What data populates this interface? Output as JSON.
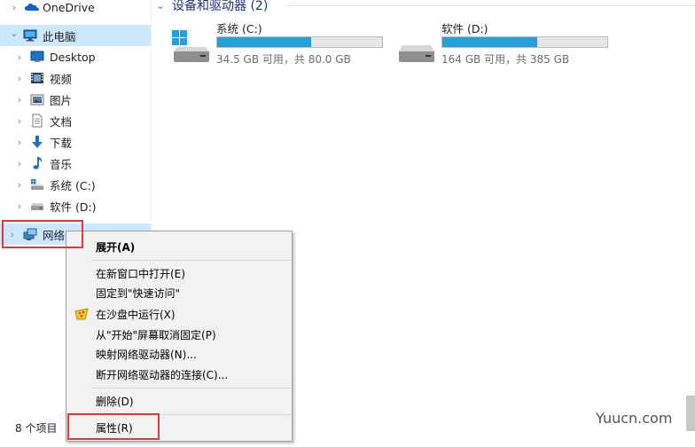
{
  "nav": {
    "items": [
      {
        "label": "OneDrive",
        "icon": "onedrive-cloud-icon",
        "chevron": "›"
      },
      {
        "label": "此电脑",
        "icon": "this-pc-icon",
        "chevron": "⌄"
      },
      {
        "label": "Desktop",
        "icon": "desktop-folder-icon",
        "chevron": "›"
      },
      {
        "label": "视频",
        "icon": "videos-folder-icon",
        "chevron": "›"
      },
      {
        "label": "图片",
        "icon": "pictures-folder-icon",
        "chevron": "›"
      },
      {
        "label": "文档",
        "icon": "documents-folder-icon",
        "chevron": "›"
      },
      {
        "label": "下载",
        "icon": "downloads-arrow-icon",
        "chevron": "›"
      },
      {
        "label": "音乐",
        "icon": "music-note-icon",
        "chevron": "›"
      },
      {
        "label": "系统 (C:)",
        "icon": "system-drive-icon",
        "chevron": "›"
      },
      {
        "label": "软件 (D:)",
        "icon": "drive-icon",
        "chevron": "›"
      },
      {
        "label": "网络",
        "icon": "network-icon",
        "chevron": "›"
      }
    ]
  },
  "main": {
    "section_title": "设备和驱动器 (2)",
    "section_chevron": "⌄",
    "drives": [
      {
        "name": "系统 (C:)",
        "info": "34.5 GB 可用，共 80.0 GB",
        "used_fraction": 0.569,
        "icon": "windows-drive-icon"
      },
      {
        "name": "软件 (D:)",
        "info": "164 GB 可用，共 385 GB",
        "used_fraction": 0.574,
        "icon": "hard-drive-icon"
      }
    ]
  },
  "context_menu": {
    "items": [
      {
        "label": "展开(A)",
        "bold": true
      },
      {
        "label": "在新窗口中打开(E)"
      },
      {
        "label": "固定到\"快速访问\""
      },
      {
        "label": "在沙盘中运行(X)",
        "icon": "sandbox-icon"
      },
      {
        "label": "从\"开始\"屏幕取消固定(P)"
      },
      {
        "label": "映射网络驱动器(N)..."
      },
      {
        "label": "断开网络驱动器的连接(C)..."
      },
      {
        "label": "删除(D)"
      },
      {
        "label": "属性(R)"
      }
    ]
  },
  "status": {
    "item_count": "8 个项目"
  },
  "watermark": "Yuucn.com",
  "colors": {
    "selection": "#cce8ff",
    "drive_bar_fill": "#26a0da",
    "highlight_box": "#e53935",
    "section_title": "#1e3287"
  }
}
